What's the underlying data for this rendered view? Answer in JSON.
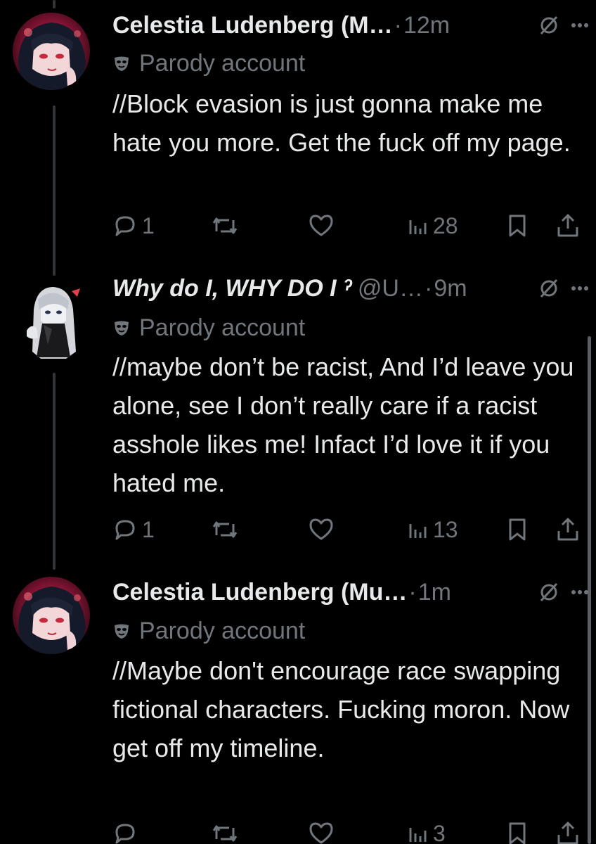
{
  "colors": {
    "background": "#000000",
    "primary_text": "#e7e9ea",
    "secondary_text": "#71767b",
    "thread_line": "#333639"
  },
  "tweets": [
    {
      "display_name": "Celestia Ludenberg (M…",
      "handle": "",
      "dot": "·",
      "time": "12m",
      "label": "Parody account",
      "text": "//Block evasion is just gonna make me hate you more. Get the fuck off my page.",
      "replies": "1",
      "reposts": "",
      "likes": "",
      "views": "28",
      "avatar": "celestia-avatar"
    },
    {
      "display_name": "Why do I, WHY DO I ˀ",
      "handle": "@U…",
      "dot": "·",
      "time": "9m",
      "label": "Parody account",
      "text": "//maybe don’t be racist,  And I’d leave you alone, see I don’t really care if a racist asshole likes me! Infact I’d love it if you hated me.",
      "replies": "1",
      "reposts": "",
      "likes": "",
      "views": "13",
      "avatar": "white-haired-character-avatar"
    },
    {
      "display_name": "Celestia Ludenberg (Mu…",
      "handle": "",
      "dot": "·",
      "time": "1m",
      "label": "Parody account",
      "text": "//Maybe don't encourage race swapping fictional characters. Fucking moron. Now get off my timeline.",
      "replies": "",
      "reposts": "",
      "likes": "",
      "views": "3",
      "avatar": "celestia-avatar"
    }
  ]
}
